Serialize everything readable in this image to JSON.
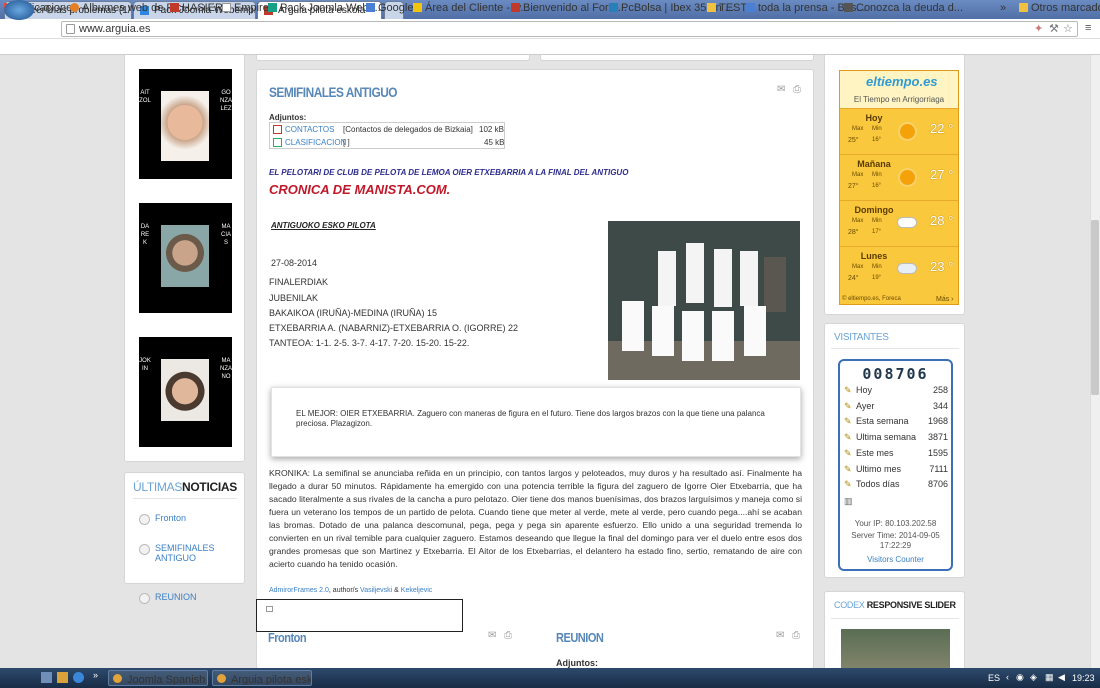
{
  "browser": {
    "tabs": [
      "Leer mas problemas (1/1)",
      "Pack Joomla Webempresa",
      "Arguia pilota eskola"
    ],
    "url": "www.arguia.es",
    "bookmarks": [
      "Aplicaciones",
      "Albumes web de Pic...",
      "HASIERA",
      "Empire",
      "Pack Joomla Webe...",
      "Google",
      "Área del Cliente - w...",
      "Bienvenido al Foro ...",
      "PcBolsa | Ibex 35 en ...",
      "TEST",
      "toda la prensa - Bus...",
      "Conozca la deuda d..."
    ],
    "bookmarks_more": "»",
    "other_bookmarks": "Otros marcadores"
  },
  "players": [
    {
      "first": "AITZOL",
      "last": "GONZALEZ"
    },
    {
      "first": "DAREK",
      "last": "MACIAS"
    },
    {
      "first": "JOKIN",
      "last": "MANZANO"
    }
  ],
  "news": {
    "title_a": "ÚLTIMAS",
    "title_b": "NOTICIAS",
    "items": [
      "Fronton",
      "SEMIFINALES ANTIGUO",
      "REUNION"
    ]
  },
  "article": {
    "title": "SEMIFINALES ANTIGUO",
    "attachments_label": "Adjuntos:",
    "attachments": [
      {
        "name": "CONTACTOS",
        "desc": "[Contactos de delegados de Bizkaia]",
        "size": "102 kB"
      },
      {
        "name": "CLASIFICACION",
        "desc": "[ ]",
        "size": "45 kB"
      }
    ],
    "subtitle": "EL PELOTARI DE CLUB DE PELOTA DE LEMOA OIER ETXEBARRIA A LA FINAL DEL ANTIGUO",
    "cronica": "CRONICA DE MANISTA.COM.",
    "heading": "ANTIGUOKO ESKO PILOTA",
    "date": "27-08-2014",
    "lines": [
      "FINALERDIAK",
      "JUBENILAK",
      "BAKAIKOA (IRUÑA)-MEDINA (IRUÑA) 15",
      "ETXEBARRIA A. (NABARNIZ)-ETXEBARRIA O. (IGORRE) 22",
      "TANTEOA: 1-1. 2-5. 3-7. 4-17. 7-20. 15-20. 15-22."
    ],
    "quote": "EL MEJOR: OIER ETXEBARRIA. Zaguero con maneras de figura en el futuro. Tiene dos largos brazos con la que tiene una palanca preciosa. Plazagizon.",
    "kronika": "KRONIKA: La semifinal se anunciaba reñida en un principio, con tantos largos y peloteados, muy duros y ha resultado así. Finalmente ha llegado a durar 50 minutos. Rápidamente ha emergido con una potencia terrible la figura del zaguero de Igorre Oier Etxebarria, que ha sacado literalmente a sus rivales de la cancha a puro pelotazo. Oier tiene dos manos buenísimas, dos brazos larguísimos y maneja como si fuera un veterano los tempos de un partido de pelota. Cuando tiene que meter al verde, mete al verde, pero cuando pega....ahí se acaban las bromas. Dotado de una palanca descomunal, pega, pega y pega sin aparente esfuerzo. Ello unido a una seguridad tremenda lo convierten en un rival temible para cualquier zaguero. Estamos deseando que llegue la final del domingo para ver el duelo entre esos dos grandes promesas que son Martinez y Etxebarria. El Aitor de los Etxebarrias, el delantero ha estado fino, sertio, rematando de aire con acierto cuando ha tenido ocasión.",
    "credit_a": "AdmirorFrames 2.0",
    "credit_b": ", author/s",
    "credit_c": "Vasiljevski",
    "credit_d": "&",
    "credit_e": "Kekeljevic"
  },
  "next": {
    "left_title": "Fronton",
    "right_title": "REUNION",
    "right_att": "Adjuntos:"
  },
  "weather": {
    "brand": "eltiempo.es",
    "subtitle": "El Tiempo en Arrigorriaga",
    "days": [
      {
        "day": "Hoy",
        "max": "25°",
        "min": "16°",
        "temp": "22 °",
        "icon": "sun"
      },
      {
        "day": "Mañana",
        "max": "27°",
        "min": "16°",
        "temp": "27 °",
        "icon": "sun"
      },
      {
        "day": "Domingo",
        "max": "28°",
        "min": "17°",
        "temp": "28 °",
        "icon": "cloud"
      },
      {
        "day": "Lunes",
        "max": "24°",
        "min": "19°",
        "temp": "23 °",
        "icon": "rain"
      }
    ],
    "max_label": "Max",
    "min_label": "Min",
    "footer_left": "© eltiempo.es, Foreca",
    "footer_right": "Más ›"
  },
  "visitors": {
    "title": "VISITANTES",
    "count": "008706",
    "rows": [
      {
        "label": "Hoy",
        "value": "258"
      },
      {
        "label": "Ayer",
        "value": "344"
      },
      {
        "label": "Esta semana",
        "value": "1968"
      },
      {
        "label": "Ultima semana",
        "value": "3871"
      },
      {
        "label": "Este mes",
        "value": "1595"
      },
      {
        "label": "Ultimo mes",
        "value": "7111"
      },
      {
        "label": "Todos días",
        "value": "8706"
      }
    ],
    "ip": "Your IP: 80.103.202.58",
    "server_time": "Server Time: 2014-09-05",
    "server_clock": "17:22:29",
    "link": "Visitors Counter"
  },
  "slider": {
    "title_a": "CODEX",
    "title_b": "RESPONSIVE SLIDER"
  },
  "taskbar": {
    "items": [
      "Joomla Spanish Serv...",
      "Arguia pilota eskola ..."
    ],
    "lang": "ES",
    "clock": "19:23"
  }
}
